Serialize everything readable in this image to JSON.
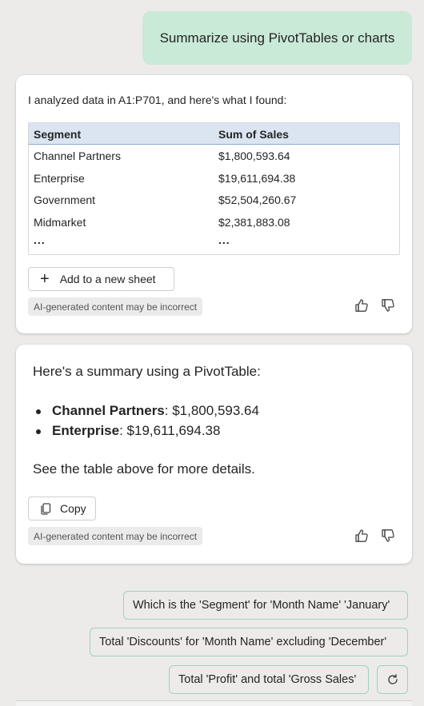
{
  "user_message": "Summarize using PivotTables or charts",
  "response1": {
    "intro": "I analyzed data in A1:P701, and here's what I found:",
    "table": {
      "headers": [
        "Segment",
        "Sum of Sales"
      ],
      "rows": [
        [
          "Channel Partners",
          "$1,800,593.64"
        ],
        [
          "Enterprise",
          "$19,611,694.38"
        ],
        [
          "Government",
          "$52,504,260.67"
        ],
        [
          "Midmarket",
          "$2,381,883.08"
        ],
        [
          "...",
          "..."
        ]
      ]
    },
    "add_button": "Add to a new sheet",
    "disclaimer": "AI-generated content may be incorrect"
  },
  "response2": {
    "summary": "Here's a summary using a PivotTable:",
    "bullets": [
      {
        "label": "Channel Partners",
        "value": "$1,800,593.64"
      },
      {
        "label": "Enterprise",
        "value": "$19,611,694.38"
      }
    ],
    "see_more": "See the table above for more details.",
    "copy_button": "Copy",
    "disclaimer": "AI-generated content may be incorrect"
  },
  "suggestions": [
    "Which is the 'Segment' for 'Month Name' 'January'",
    "Total 'Discounts' for 'Month Name' excluding 'December'",
    "Total 'Profit' and total 'Gross Sales'"
  ],
  "icons": {
    "add": "plus-icon",
    "copy": "copy-icon",
    "like": "thumbs-up-icon",
    "dislike": "thumbs-down-icon",
    "refresh": "refresh-icon"
  }
}
